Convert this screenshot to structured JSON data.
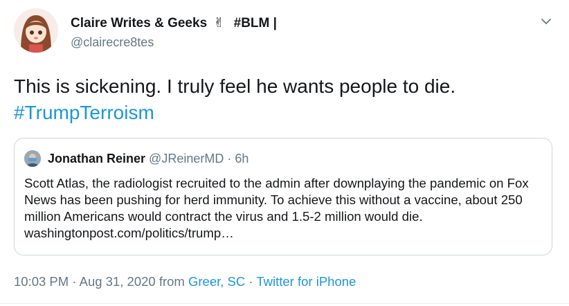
{
  "author": {
    "name": "Claire Writes & Geeks",
    "emoji": "✌",
    "name_suffix": "#BLM |",
    "handle": "@clairecre8tes"
  },
  "tweet": {
    "text": "This is sickening. I truly feel he wants people to die.",
    "hashtag": "#TrumpTerroism"
  },
  "quoted_tweet": {
    "name": "Jonathan Reiner",
    "handle": "@JReinerMD",
    "separator": "·",
    "time": "6h",
    "text": "Scott Atlas, the radiologist recruited to the admin after downplaying the pandemic on Fox News has been pushing for herd immunity. To achieve this without a vaccine, about 250 million Americans would contract the virus and 1.5-2 million would die.  ",
    "link": "washingtonpost.com/politics/trump…"
  },
  "meta": {
    "time": "10:03 PM",
    "sep1": "·",
    "date": "Aug 31, 2020",
    "from": "from",
    "location": "Greer, SC",
    "sep2": "·",
    "source": "Twitter for iPhone"
  },
  "icons": {
    "menu": "chevron-down-icon",
    "avatar": "avatar",
    "quoted_avatar": "avatar"
  },
  "colors": {
    "link": "#1b95e0",
    "secondary_text": "#657786",
    "border": "#ccd6dd"
  }
}
